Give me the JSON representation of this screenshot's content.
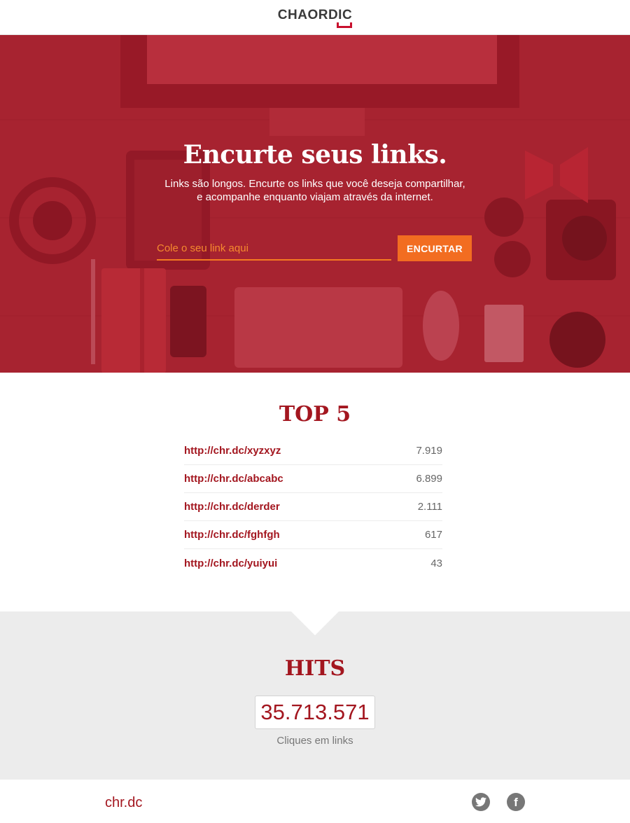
{
  "header": {
    "logo_text": "CHAORDIC"
  },
  "hero": {
    "title": "Encurte seus links.",
    "subtitle_line1": "Links são longos. Encurte os links que você deseja compartilhar,",
    "subtitle_line2": "e acompanhe enquanto viajam através da internet.",
    "input_placeholder": "Cole o seu link aqui",
    "input_value": "",
    "button_label": "ENCURTAR"
  },
  "top5": {
    "title": "TOP 5",
    "items": [
      {
        "url": "http://chr.dc/xyzxyz",
        "count": "7.919"
      },
      {
        "url": "http://chr.dc/abcabc",
        "count": "6.899"
      },
      {
        "url": "http://chr.dc/derder",
        "count": "2.111"
      },
      {
        "url": "http://chr.dc/fghfgh",
        "count": "617"
      },
      {
        "url": "http://chr.dc/yuiyui",
        "count": "43"
      }
    ]
  },
  "hits": {
    "title": "HITS",
    "value": "35.713.571",
    "caption": "Cliques em links"
  },
  "footer": {
    "brand": "chr.dc",
    "social": [
      {
        "name": "twitter",
        "icon": "twitter-icon"
      },
      {
        "name": "facebook",
        "icon": "facebook-icon"
      }
    ]
  },
  "colors": {
    "brand_red": "#a3161f",
    "accent_orange": "#f26d21",
    "hero_overlay": "#b01e2d",
    "hits_bg": "#ececec",
    "social_gray": "#777777"
  }
}
